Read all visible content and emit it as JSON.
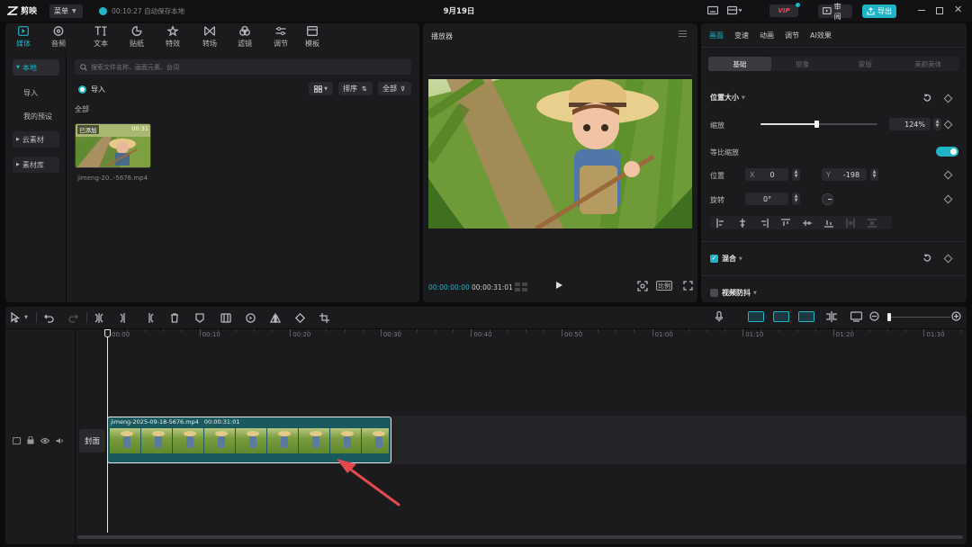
{
  "titlebar": {
    "app_name": "剪映",
    "menu_label": "菜单",
    "autosave": "00:10:27 自动保存本地",
    "project_title": "9月19日",
    "vip_label": "VIP",
    "review_label": "审阅",
    "export_label": "导出"
  },
  "media_tabs": [
    {
      "label": "媒体",
      "icon": "media-icon",
      "active": true
    },
    {
      "label": "音频",
      "icon": "audio-icon"
    },
    {
      "label": "文本",
      "icon": "text-icon"
    },
    {
      "label": "贴纸",
      "icon": "sticker-icon"
    },
    {
      "label": "特效",
      "icon": "effects-icon"
    },
    {
      "label": "转场",
      "icon": "transition-icon"
    },
    {
      "label": "滤镜",
      "icon": "filter-icon"
    },
    {
      "label": "调节",
      "icon": "adjust-icon"
    },
    {
      "label": "模板",
      "icon": "template-icon"
    }
  ],
  "sidebar": {
    "local": "本地",
    "import": "导入",
    "presets": "我的预设",
    "cloud": "云素材",
    "library": "素材库"
  },
  "media": {
    "search_placeholder": "搜索文件名称、画面元素、台词",
    "import_button": "导入",
    "sort_label": "排序",
    "all_filter": "全部",
    "section_all": "全部",
    "clip": {
      "badge": "已添加",
      "duration": "00:31",
      "filename": "jimeng-20..-5676.mp4"
    }
  },
  "player": {
    "title": "播放器",
    "current_time": "00:00:00:00",
    "total_time": "00:00:31:01",
    "ratio_label": "比例"
  },
  "inspector": {
    "tabs": [
      {
        "label": "画面",
        "active": true
      },
      {
        "label": "变速"
      },
      {
        "label": "动画"
      },
      {
        "label": "调节"
      },
      {
        "label": "AI效果"
      }
    ],
    "subtabs": [
      {
        "label": "基础",
        "active": true
      },
      {
        "label": "抠像"
      },
      {
        "label": "蒙版"
      },
      {
        "label": "美颜美体"
      }
    ],
    "position_size": "位置大小",
    "scale_label": "缩放",
    "scale_value": "124%",
    "scale_fraction": 0.48,
    "uniform_scale": "等比缩放",
    "position_label": "位置",
    "x_label": "X",
    "x_value": "0",
    "y_label": "Y",
    "y_value": "-198",
    "rotate_label": "旋转",
    "rotate_value": "0°",
    "blend_label": "混合",
    "stabilize_label": "视频防抖"
  },
  "timeline": {
    "ruler": [
      "00:00",
      "00:10",
      "00:20",
      "00:30",
      "00:40",
      "00:50",
      "01:00",
      "01:10",
      "01:20",
      "01:30"
    ],
    "cover_label": "封面",
    "clip_name": "jimeng-2025-09-18-5676.mp4",
    "clip_duration": "00:00:31:01"
  },
  "colors": {
    "accent": "#1fb5c6",
    "clip_bg": "#1a5a5f",
    "vip": "#e84a5f"
  }
}
